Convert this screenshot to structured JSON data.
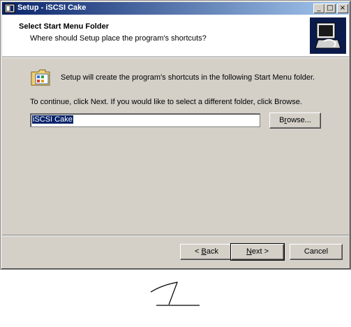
{
  "window": {
    "title": "Setup - iSCSI Cake",
    "controls": {
      "minimize": "_",
      "maximize": "□",
      "close": "×"
    }
  },
  "header": {
    "title": "Select Start Menu Folder",
    "subtitle": "Where should Setup place the program's shortcuts?"
  },
  "body": {
    "info": "Setup will create the program's shortcuts in the following Start Menu folder.",
    "instruction": "To continue, click Next. If you would like to select a different folder, click Browse.",
    "folder_value": "iSCSI Cake"
  },
  "buttons": {
    "browse": {
      "pre": "B",
      "acc": "r",
      "post": "owse..."
    },
    "back": {
      "pre": "< ",
      "acc": "B",
      "post": "ack"
    },
    "next": {
      "pre": "",
      "acc": "N",
      "post": "ext >"
    },
    "cancel": "Cancel"
  },
  "icons": [
    "setup-app-icon",
    "setup-logo-icon",
    "start-menu-folder-icon"
  ],
  "colors": {
    "titlebar_start": "#0a246a",
    "titlebar_end": "#a6caf0",
    "face": "#d4d0c8",
    "selection": "#0a246a"
  }
}
